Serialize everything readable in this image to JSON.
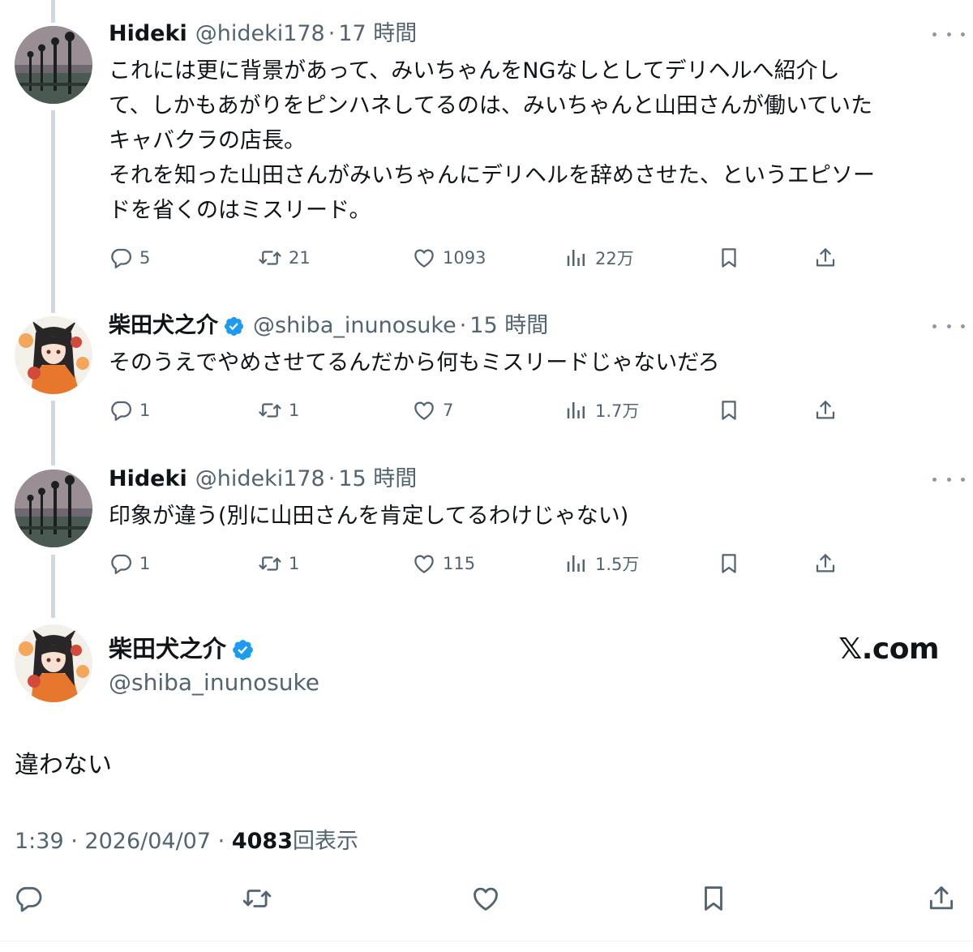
{
  "tweets": [
    {
      "name": "Hideki",
      "handle": "@hideki178",
      "sep": "·",
      "time": "17 時間",
      "text": "これには更に背景があって、みいちゃんをNGなしとしてデリヘルへ紹介し\nて、しかもあがりをピンハネしてるのは、みいちゃんと山田さんが働いていた\nキャバクラの店長。\nそれを知った山田さんがみいちゃんにデリヘルを辞めさせた、というエピソー\nドを省くのはミスリード。",
      "replies": "5",
      "reposts": "21",
      "likes": "1093",
      "views": "22万"
    },
    {
      "name": "柴田犬之介",
      "handle": "@shiba_inunosuke",
      "sep": "·",
      "time": "15 時間",
      "text": "そのうえでやめさせてるんだから何もミスリードじゃないだろ",
      "replies": "1",
      "reposts": "1",
      "likes": "7",
      "views": "1.7万"
    },
    {
      "name": "Hideki",
      "handle": "@hideki178",
      "sep": "·",
      "time": "15 時間",
      "text": "印象が違う(別に山田さんを肯定してるわけじゃない)",
      "replies": "1",
      "reposts": "1",
      "likes": "115",
      "views": "1.5万"
    }
  ],
  "main": {
    "name": "柴田犬之介",
    "handle": "@shiba_inunosuke",
    "brand": "𝕏.com",
    "text": "違わない",
    "time": "1:39",
    "sep": "·",
    "date": "2026/04/07",
    "views_count": "4083",
    "views_label": "回表示"
  },
  "icons": [
    "reply-icon",
    "repost-icon",
    "like-icon",
    "views-icon",
    "bookmark-icon",
    "share-icon",
    "verified-badge-icon",
    "more-icon"
  ],
  "colors": {
    "text_primary": "#0f1419",
    "text_secondary": "#536471",
    "verified_blue": "#1d9bf0",
    "thread_line": "#cfd9de"
  }
}
